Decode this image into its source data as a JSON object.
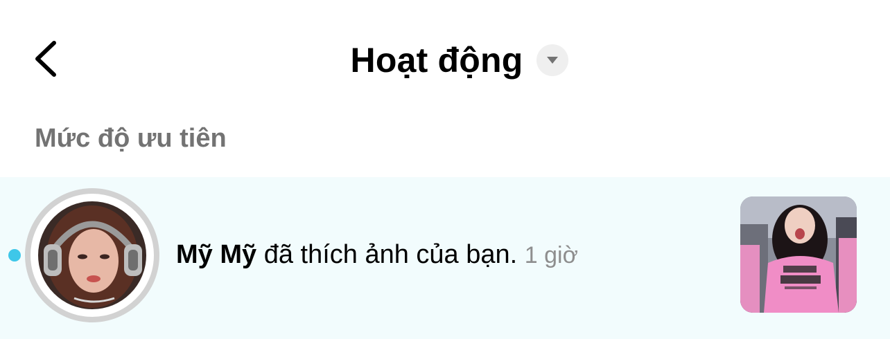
{
  "header": {
    "title": "Hoạt động"
  },
  "section": {
    "label": "Mức độ ưu tiên"
  },
  "notification": {
    "username": "Mỹ Mỹ",
    "action": " đã thích ảnh của bạn. ",
    "time": "1 giờ",
    "unread": true,
    "unread_color": "#3ec7e9"
  },
  "icons": {
    "back": "back-chevron-icon",
    "dropdown": "caret-down-icon"
  },
  "colors": {
    "row_highlight": "#f2fcfd",
    "section_label": "#737373",
    "time_text": "#8e8e8e"
  }
}
